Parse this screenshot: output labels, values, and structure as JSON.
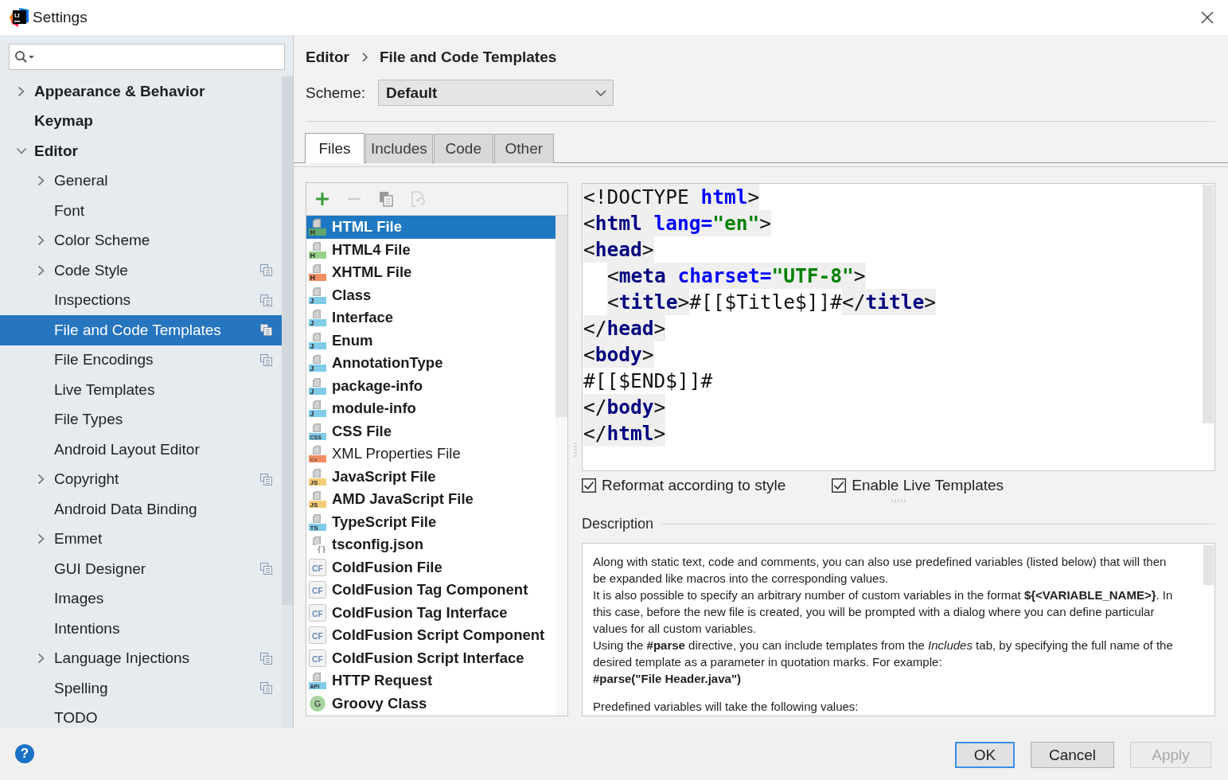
{
  "window": {
    "title": "Settings",
    "logo_text": "IJ"
  },
  "sidebar": {
    "items": [
      {
        "label": "Appearance & Behavior",
        "expanded": false,
        "selected": false,
        "project_level": false
      },
      {
        "label": "Keymap",
        "selected": false,
        "project_level": false
      },
      {
        "label": "Editor",
        "expanded": true,
        "selected": false,
        "project_level": false,
        "children": [
          {
            "label": "General",
            "expanded": false,
            "selected": false,
            "project_level": false
          },
          {
            "label": "Font",
            "selected": false,
            "project_level": false
          },
          {
            "label": "Color Scheme",
            "expanded": false,
            "selected": false,
            "project_level": false
          },
          {
            "label": "Code Style",
            "expanded": false,
            "selected": false,
            "project_level": true
          },
          {
            "label": "Inspections",
            "selected": false,
            "project_level": true
          },
          {
            "label": "File and Code Templates",
            "selected": true,
            "project_level": true
          },
          {
            "label": "File Encodings",
            "selected": false,
            "project_level": true
          },
          {
            "label": "Live Templates",
            "selected": false,
            "project_level": false
          },
          {
            "label": "File Types",
            "selected": false,
            "project_level": false
          },
          {
            "label": "Android Layout Editor",
            "selected": false,
            "project_level": false
          },
          {
            "label": "Copyright",
            "expanded": false,
            "selected": false,
            "project_level": true
          },
          {
            "label": "Android Data Binding",
            "selected": false,
            "project_level": false
          },
          {
            "label": "Emmet",
            "expanded": false,
            "selected": false,
            "project_level": false
          },
          {
            "label": "GUI Designer",
            "selected": false,
            "project_level": true
          },
          {
            "label": "Images",
            "selected": false,
            "project_level": false
          },
          {
            "label": "Intentions",
            "selected": false,
            "project_level": false
          },
          {
            "label": "Language Injections",
            "expanded": false,
            "selected": false,
            "project_level": true
          },
          {
            "label": "Spelling",
            "selected": false,
            "project_level": true
          },
          {
            "label": "TODO",
            "selected": false,
            "project_level": false
          }
        ]
      }
    ]
  },
  "breadcrumb": [
    "Editor",
    "File and Code Templates"
  ],
  "scheme": {
    "label": "Scheme:",
    "value": "Default"
  },
  "tabs": [
    {
      "label": "Files",
      "selected": true
    },
    {
      "label": "Includes",
      "selected": false
    },
    {
      "label": "Code",
      "selected": false
    },
    {
      "label": "Other",
      "selected": false
    }
  ],
  "template_toolbar": [
    {
      "kind": "add",
      "disabled": false
    },
    {
      "kind": "remove",
      "disabled": true
    },
    {
      "kind": "copy",
      "disabled": false
    },
    {
      "kind": "reset",
      "disabled": true
    }
  ],
  "templates": [
    {
      "name": "HTML File",
      "kind": "file",
      "badge": "H",
      "color": "#5fa66c",
      "bold": true,
      "selected": true
    },
    {
      "name": "HTML4 File",
      "kind": "file",
      "badge": "H",
      "color": "#98d18a",
      "bold": true,
      "selected": false
    },
    {
      "name": "XHTML File",
      "kind": "file",
      "badge": "H",
      "color": "#f28c63",
      "bold": true,
      "selected": false
    },
    {
      "name": "Class",
      "kind": "file",
      "badge": "J",
      "color": "#80cbe8",
      "bold": true,
      "selected": false
    },
    {
      "name": "Interface",
      "kind": "file",
      "badge": "J",
      "color": "#80cbe8",
      "bold": true,
      "selected": false
    },
    {
      "name": "Enum",
      "kind": "file",
      "badge": "J",
      "color": "#80cbe8",
      "bold": true,
      "selected": false
    },
    {
      "name": "AnnotationType",
      "kind": "file",
      "badge": "J",
      "color": "#80cbe8",
      "bold": true,
      "selected": false
    },
    {
      "name": "package-info",
      "kind": "file",
      "badge": "J",
      "color": "#80cbe8",
      "bold": true,
      "selected": false
    },
    {
      "name": "module-info",
      "kind": "file",
      "badge": "J",
      "color": "#80cbe8",
      "bold": true,
      "selected": false
    },
    {
      "name": "CSS File",
      "kind": "file",
      "badge": "CSS",
      "color": "#80cbe8",
      "bold": true,
      "selected": false
    },
    {
      "name": "XML Properties File",
      "kind": "file",
      "badge": "<>",
      "color": "#f28c63",
      "bold": false,
      "selected": false
    },
    {
      "name": "JavaScript File",
      "kind": "file",
      "badge": "JS",
      "color": "#f6cd76",
      "bold": true,
      "selected": false
    },
    {
      "name": "AMD JavaScript File",
      "kind": "file",
      "badge": "JS",
      "color": "#f6cd76",
      "bold": true,
      "selected": false
    },
    {
      "name": "TypeScript File",
      "kind": "file",
      "badge": "TS",
      "color": "#80cbe8",
      "bold": true,
      "selected": false
    },
    {
      "name": "tsconfig.json",
      "kind": "json",
      "badge": "{}",
      "color": "#8c8c8c",
      "bold": true,
      "selected": false
    },
    {
      "name": "ColdFusion File",
      "kind": "tile",
      "badge": "CF",
      "color": "#6d8fb5",
      "bold": true,
      "selected": false
    },
    {
      "name": "ColdFusion Tag Component",
      "kind": "tile",
      "badge": "CF",
      "color": "#6d8fb5",
      "bold": true,
      "selected": false
    },
    {
      "name": "ColdFusion Tag Interface",
      "kind": "tile",
      "badge": "CF",
      "color": "#6d8fb5",
      "bold": true,
      "selected": false
    },
    {
      "name": "ColdFusion Script Component",
      "kind": "tile",
      "badge": "CF",
      "color": "#6d8fb5",
      "bold": true,
      "selected": false
    },
    {
      "name": "ColdFusion Script Interface",
      "kind": "tile",
      "badge": "CF",
      "color": "#6d8fb5",
      "bold": true,
      "selected": false
    },
    {
      "name": "HTTP Request",
      "kind": "file",
      "badge": "API",
      "color": "#80cbe8",
      "bold": true,
      "selected": false
    },
    {
      "name": "Groovy Class",
      "kind": "circle",
      "badge": "G",
      "color": "#a8d5a0",
      "bold": true,
      "selected": false
    }
  ],
  "editor": {
    "lines": [
      {
        "indented": false,
        "tokens": [
          {
            "kind": "punct",
            "text": "<!DOCTYPE "
          },
          {
            "kind": "attr",
            "text": "html"
          },
          {
            "kind": "punct",
            "text": ">"
          }
        ]
      },
      {
        "indented": false,
        "tokens": [
          {
            "kind": "punct",
            "text": "<"
          },
          {
            "kind": "tag",
            "text": "html"
          },
          {
            "kind": "attr",
            "text": " lang="
          },
          {
            "kind": "string",
            "text": "\"en\""
          },
          {
            "kind": "punct",
            "text": ">"
          }
        ]
      },
      {
        "indented": false,
        "tokens": [
          {
            "kind": "punct",
            "text": "<"
          },
          {
            "kind": "tag",
            "text": "head"
          },
          {
            "kind": "punct",
            "text": ">"
          }
        ]
      },
      {
        "indented": true,
        "tokens": [
          {
            "kind": "punct",
            "text": "<"
          },
          {
            "kind": "tag",
            "text": "meta"
          },
          {
            "kind": "attr",
            "text": " charset="
          },
          {
            "kind": "string",
            "text": "\"UTF-8\""
          },
          {
            "kind": "punct",
            "text": ">"
          }
        ]
      },
      {
        "indented": true,
        "tokens": [
          {
            "kind": "punct",
            "text": "<"
          },
          {
            "kind": "tag",
            "text": "title"
          },
          {
            "kind": "punct",
            "text": ">"
          },
          {
            "kind": "literal",
            "text": "#[[$Title$]]#"
          },
          {
            "kind": "punct",
            "text": "</"
          },
          {
            "kind": "tag",
            "text": "title"
          },
          {
            "kind": "punct",
            "text": ">"
          }
        ]
      },
      {
        "indented": false,
        "tokens": [
          {
            "kind": "punct",
            "text": "</"
          },
          {
            "kind": "tag",
            "text": "head"
          },
          {
            "kind": "punct",
            "text": ">"
          }
        ]
      },
      {
        "indented": false,
        "tokens": [
          {
            "kind": "punct",
            "text": "<"
          },
          {
            "kind": "tag",
            "text": "body"
          },
          {
            "kind": "punct",
            "text": ">"
          }
        ]
      },
      {
        "indented": false,
        "tokens": [
          {
            "kind": "literal",
            "text": "#[[$END$]]#"
          }
        ]
      },
      {
        "indented": false,
        "tokens": [
          {
            "kind": "punct",
            "text": "</"
          },
          {
            "kind": "tag",
            "text": "body"
          },
          {
            "kind": "punct",
            "text": ">"
          }
        ]
      },
      {
        "indented": false,
        "tokens": [
          {
            "kind": "punct",
            "text": "</"
          },
          {
            "kind": "tag",
            "text": "html"
          },
          {
            "kind": "punct",
            "text": ">"
          }
        ]
      }
    ]
  },
  "options": [
    {
      "label": "Reformat according to style",
      "checked": true
    },
    {
      "label": "Enable Live Templates",
      "checked": true
    }
  ],
  "description": {
    "title": "Description",
    "paragraphs": [
      {
        "kind": "text",
        "text": "Along with static text, code and comments, you can also use predefined variables (listed below) that will then be expanded like macros into the corresponding values."
      },
      {
        "kind": "text",
        "text": "It is also possible to specify an arbitrary number of custom variables in the format **${<VARIABLE_NAME>}**. In this case, before the new file is created, you will be prompted with a dialog where you can define particular values for all custom variables."
      },
      {
        "kind": "text",
        "text": "Using the **#parse** directive, you can include templates from the *Includes* tab, by specifying the full name of the desired template as a parameter in quotation marks. For example:"
      },
      {
        "kind": "example",
        "text": "#parse(\"File Header.java\")"
      },
      {
        "kind": "text",
        "text": "Predefined variables will take the following values:"
      }
    ]
  },
  "help_button": "?",
  "buttons": [
    {
      "label": "OK",
      "kind": "default",
      "disabled": false
    },
    {
      "label": "Cancel",
      "kind": "normal",
      "disabled": false
    },
    {
      "label": "Apply",
      "kind": "normal",
      "disabled": true
    }
  ]
}
